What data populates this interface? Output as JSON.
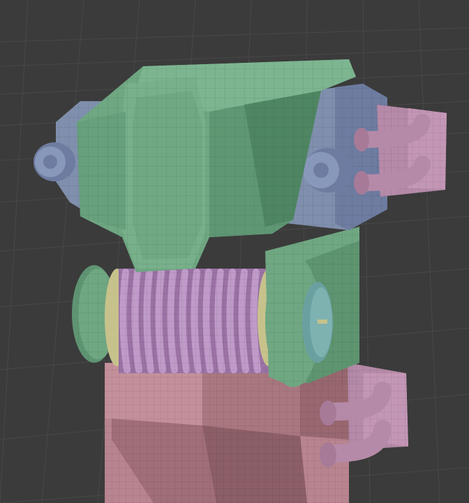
{
  "viewport": {
    "background": "#3b3b3b",
    "grid_color": "#4a4a4a",
    "wire_color": "#26302a"
  },
  "model_parts": [
    {
      "name": "armor-block",
      "color": "#6fa782"
    },
    {
      "name": "side-housing",
      "color": "#7f8fad"
    },
    {
      "name": "spring-coil",
      "color": "#a77eb0"
    },
    {
      "name": "coil-bushing",
      "color": "#c7c28c"
    },
    {
      "name": "end-cap",
      "color": "#7eb2b1"
    },
    {
      "name": "base-body",
      "color": "#b8848f"
    },
    {
      "name": "pipe-fitting",
      "color": "#b58aa8"
    }
  ]
}
